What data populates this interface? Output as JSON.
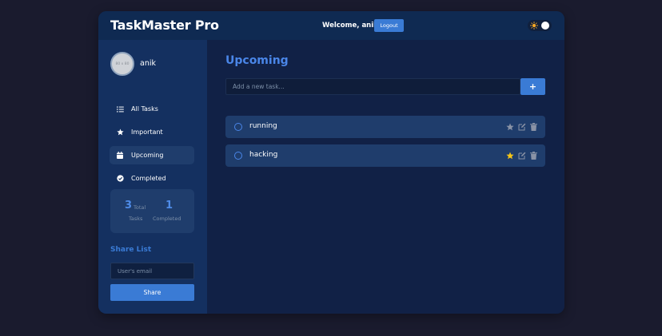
{
  "header": {
    "brand": "TaskMaster Pro",
    "welcome": "Welcome, anik",
    "logout_label": "Logout"
  },
  "sidebar": {
    "avatar_text": "80 x 80",
    "username": "anik",
    "nav": [
      {
        "label": "All Tasks",
        "icon": "list-icon",
        "active": false
      },
      {
        "label": "Important",
        "icon": "star-icon",
        "active": false
      },
      {
        "label": "Upcoming",
        "icon": "calendar-icon",
        "active": true
      },
      {
        "label": "Completed",
        "icon": "check-circle-icon",
        "active": false
      }
    ],
    "stats": {
      "total_value": "3",
      "total_label_1": "Total",
      "total_label_2": "Tasks",
      "completed_value": "1",
      "completed_label": "Completed"
    },
    "share": {
      "title": "Share List",
      "placeholder": "User's email",
      "button_label": "Share"
    }
  },
  "main": {
    "title": "Upcoming",
    "input_placeholder": "Add a new task...",
    "add_label": "+",
    "tasks": [
      {
        "text": "running",
        "important": false
      },
      {
        "text": "hacking",
        "important": true
      }
    ]
  },
  "colors": {
    "accent": "#3a7bd5",
    "star_active": "#f5c518",
    "star_inactive": "#8a93a6"
  }
}
